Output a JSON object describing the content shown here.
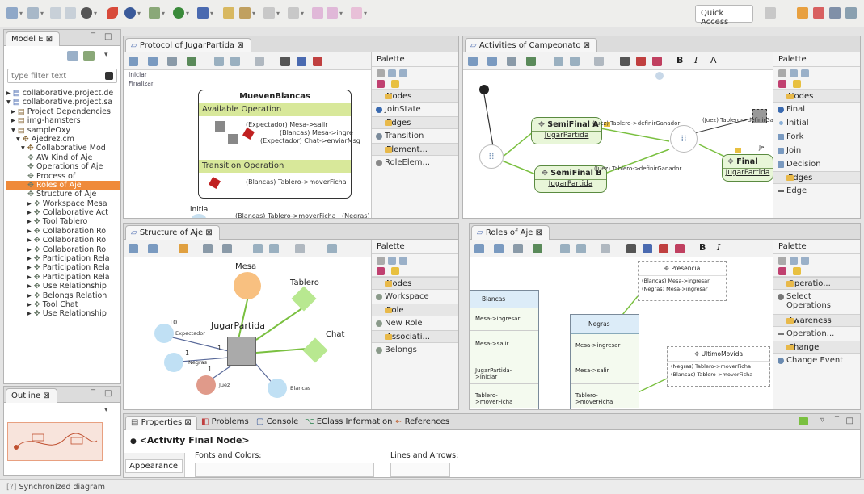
{
  "toolbar": {
    "quick_access": "Quick Access"
  },
  "model_explorer": {
    "tab": "Model E",
    "tab_close": "⊠",
    "filter_placeholder": "type filter text",
    "items": [
      "collaborative.project.de",
      "collaborative.project.sa",
      "Project Dependencies",
      "img-hamsters",
      "sampleOxy",
      "Ajedrez.cm",
      "Collaborative Mod",
      "AW Kind of Aje",
      "Operations of Aje",
      "Process of",
      "Roles of Aje",
      "Structure of Aje",
      "Workspace Mesa",
      "Collaborative Act",
      "Tool Tablero",
      "Collaboration Rol",
      "Collaboration Rol",
      "Collaboration Rol",
      "Participation Rela",
      "Participation Rela",
      "Participation Rela",
      "Use Relationship",
      "Belongs Relation",
      "Tool Chat",
      "Use Relationship"
    ]
  },
  "outline": {
    "tab": "Outline",
    "tab_close": "⊠"
  },
  "editors": {
    "protocol": {
      "tab": "Protocol of JugarPartida",
      "tab_close": "⊠",
      "outline_items": [
        "Iniciar",
        "Finalizar"
      ],
      "node_title": "MuevenBlancas",
      "section_available": "Available Operation",
      "ops": [
        "(Expectador) Mesa->salir",
        "(Blancas) Mesa->ingre",
        "(Expectador) Chat->enviarMsg"
      ],
      "section_transition": "Transition Operation",
      "transition_op": "(Blancas) Tablero->moverFicha",
      "initial": "initial",
      "bottom_labels": [
        "(Blancas) Tablero->moverFicha",
        "(Negras) Tabl"
      ]
    },
    "activities": {
      "tab": "Activities of Campeonato",
      "tab_close": "⊠",
      "format_buttons": [
        "B",
        "I",
        "A"
      ],
      "nodes": {
        "semifinal_a": "SemiFinal A",
        "semifinal_a_sub": "JugarPartida",
        "semifinal_b": "SemiFinal B",
        "semifinal_b_sub": "JugarPartida",
        "final": "Final",
        "final_sub": "JugarPartida"
      },
      "edge_labels": [
        "(Juez) Tablero->definirGanador",
        "(Juez) Tablero->definirGanador",
        "(Juez) Tablero->definirGanador",
        "Jei"
      ]
    },
    "structure": {
      "tab": "Structure of Aje",
      "tab_close": "⊠",
      "labels": {
        "mesa": "Mesa",
        "tablero": "Tablero",
        "chat": "Chat",
        "center": "JugarPartida",
        "expectador": "Expectador",
        "negras": "Negras",
        "juez": "Juez",
        "blancas": "Blancas",
        "mult_10": "10",
        "mult_1a": "1",
        "mult_1b": "1",
        "mult_1c": "1"
      }
    },
    "roles": {
      "tab": "Roles of Aje",
      "tab_close": "⊠",
      "format_buttons": [
        "B",
        "I"
      ],
      "presencia": "Presencia",
      "presencia_ops": [
        "(Blancas) Mesa->ingresar",
        "(Negras) Mesa->ingresar"
      ],
      "left_col": [
        "Blancas",
        "Mesa->ingresar",
        "Mesa->salir",
        "JugarPartida->iniciar",
        "Tablero->moverFicha"
      ],
      "mid_col": [
        "Negras",
        "Mesa->ingresar",
        "Mesa->salir",
        "Tablero->moverFicha"
      ],
      "ultimo": "UltimoMovida",
      "ultimo_ops": [
        "(Negras) Tablero->moverFicha",
        "(Blancas) Tablero->moverFicha"
      ]
    }
  },
  "palettes": {
    "protocol": {
      "title": "Palette",
      "drawers": [
        "Nodes",
        "Edges",
        "Element..."
      ],
      "items": [
        "JoinState",
        "Transition",
        "RoleElem..."
      ]
    },
    "activities": {
      "title": "Palette",
      "drawers": [
        "Nodes",
        "Edges"
      ],
      "items": [
        "Final",
        "Initial",
        "Fork",
        "Join",
        "Decision",
        "Edge"
      ]
    },
    "structure": {
      "title": "Palette",
      "drawers": [
        "Nodes",
        "Role",
        "Associati..."
      ],
      "items": [
        "Workspace",
        "New Role",
        "Belongs"
      ]
    },
    "roles": {
      "title": "Palette",
      "drawers": [
        "Operatio...",
        "Awareness",
        "Change"
      ],
      "items": [
        "Select Operations",
        "Operation...",
        "Change Event"
      ]
    }
  },
  "bottom": {
    "tabs": [
      "Properties",
      "Problems",
      "Console",
      "EClass Information",
      "References"
    ],
    "title": "<Activity Final Node>",
    "sidebar_tab": "Appearance",
    "fonts_label": "Fonts and Colors:",
    "lines_label": "Lines and Arrows:"
  },
  "status": {
    "text": "Synchronized diagram"
  }
}
